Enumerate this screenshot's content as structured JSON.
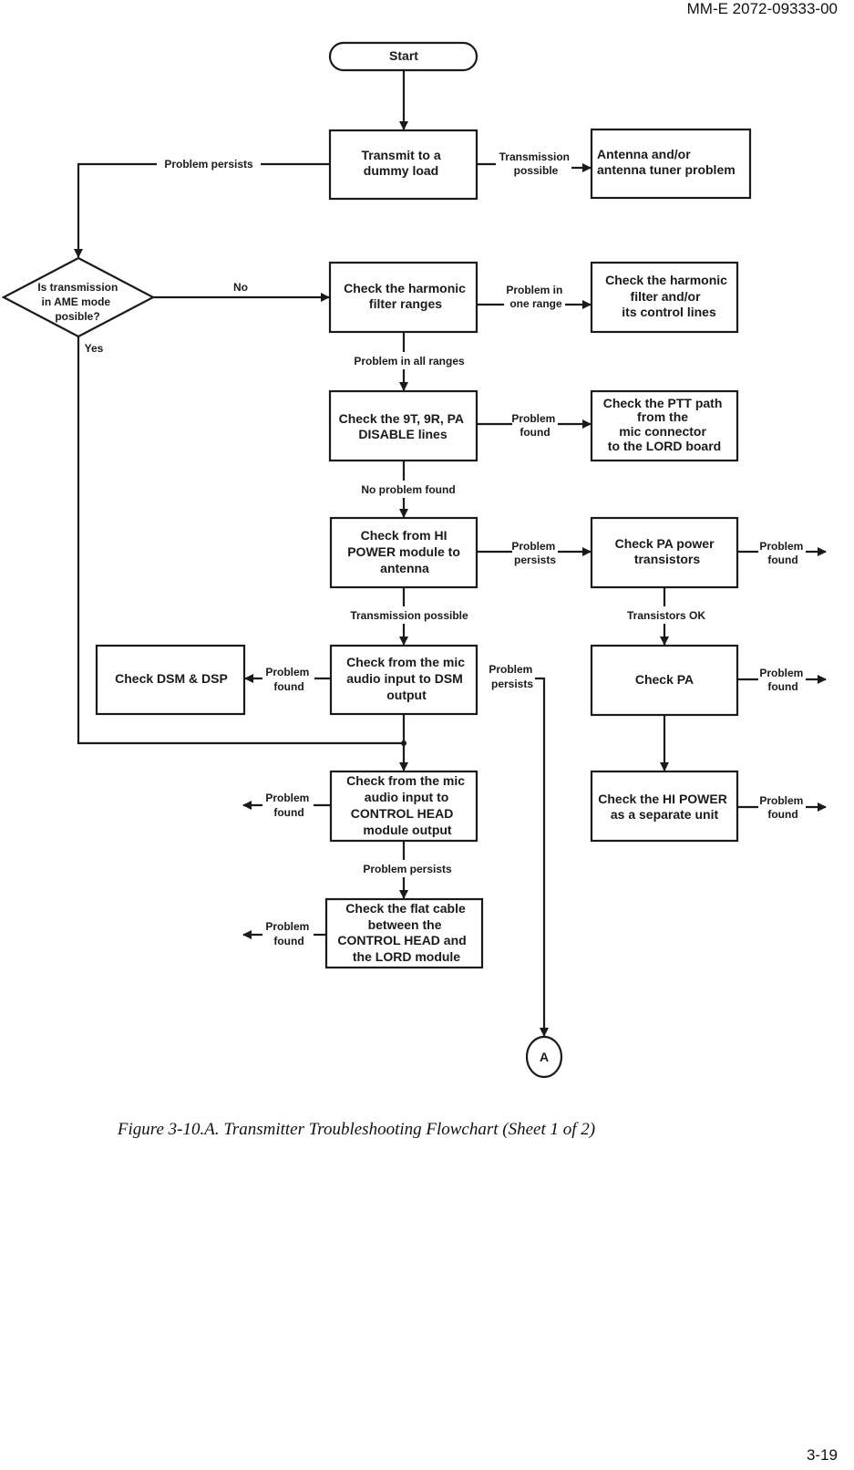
{
  "header": {
    "doc_id": "MM-E 2072-09333-00"
  },
  "footer": {
    "page_number": "3-19"
  },
  "caption": "Figure 3-10.A. Transmitter Troubleshooting Flowchart (Sheet 1 of 2)",
  "flowchart": {
    "start": {
      "label": "Start"
    },
    "nodes": {
      "dummy_load": [
        "Transmit to a",
        "dummy load"
      ],
      "antenna_tuner": [
        "Antenna and/or",
        "antenna tuner problem"
      ],
      "decision_ame": [
        "Is transmission",
        "in AME mode",
        "posible?"
      ],
      "harmonic_ranges": [
        "Check the harmonic",
        "filter ranges"
      ],
      "harmonic_filter": [
        "Check the harmonic",
        "filter and/or",
        "its control lines"
      ],
      "disable_lines": [
        "Check the 9T, 9R, PA",
        "DISABLE lines"
      ],
      "ptt_path": [
        "Check the PTT path",
        "from the",
        "mic connector",
        "to the LORD board"
      ],
      "hi_power_antenna": [
        "Check from HI",
        "POWER module to",
        "antenna"
      ],
      "pa_transistors": [
        "Check PA power",
        "transistors"
      ],
      "dsm_dsp": [
        "Check DSM & DSP"
      ],
      "mic_dsm": [
        "Check from the mic",
        "audio input to DSM",
        "output"
      ],
      "check_pa": [
        "Check PA"
      ],
      "mic_control_head": [
        "Check from the mic",
        "audio input to",
        "CONTROL HEAD",
        "module output"
      ],
      "hi_power_unit": [
        "Check the HI POWER",
        "as a separate unit"
      ],
      "flat_cable": [
        "Check the flat cable",
        "between the",
        "CONTROL HEAD and",
        "the LORD module"
      ]
    },
    "connector": {
      "label": "A"
    },
    "edge_labels": {
      "problem_persists_top": "Problem persists",
      "transmission_possible_1": [
        "Transmission",
        "possible"
      ],
      "no": "No",
      "yes": "Yes",
      "problem_in_one_range": [
        "Problem in",
        "one range"
      ],
      "problem_in_all_ranges": "Problem in all ranges",
      "problem_found_ptt": [
        "Problem",
        "found"
      ],
      "no_problem_found": "No problem found",
      "problem_persists_pa": [
        "Problem",
        "persists"
      ],
      "problem_found_pa_transistors": [
        "Problem",
        "found"
      ],
      "transmission_possible_2": "Transmission possible",
      "transistors_ok": "Transistors OK",
      "problem_found_dsm": [
        "Problem",
        "found"
      ],
      "problem_persists_mic": [
        "Problem",
        "persists"
      ],
      "problem_found_check_pa": [
        "Problem",
        "found"
      ],
      "problem_found_control_head": [
        "Problem",
        "found"
      ],
      "problem_found_hi_power": [
        "Problem",
        "found"
      ],
      "problem_persists_ch": "Problem persists",
      "problem_found_flat_cable": [
        "Problem",
        "found"
      ]
    }
  }
}
